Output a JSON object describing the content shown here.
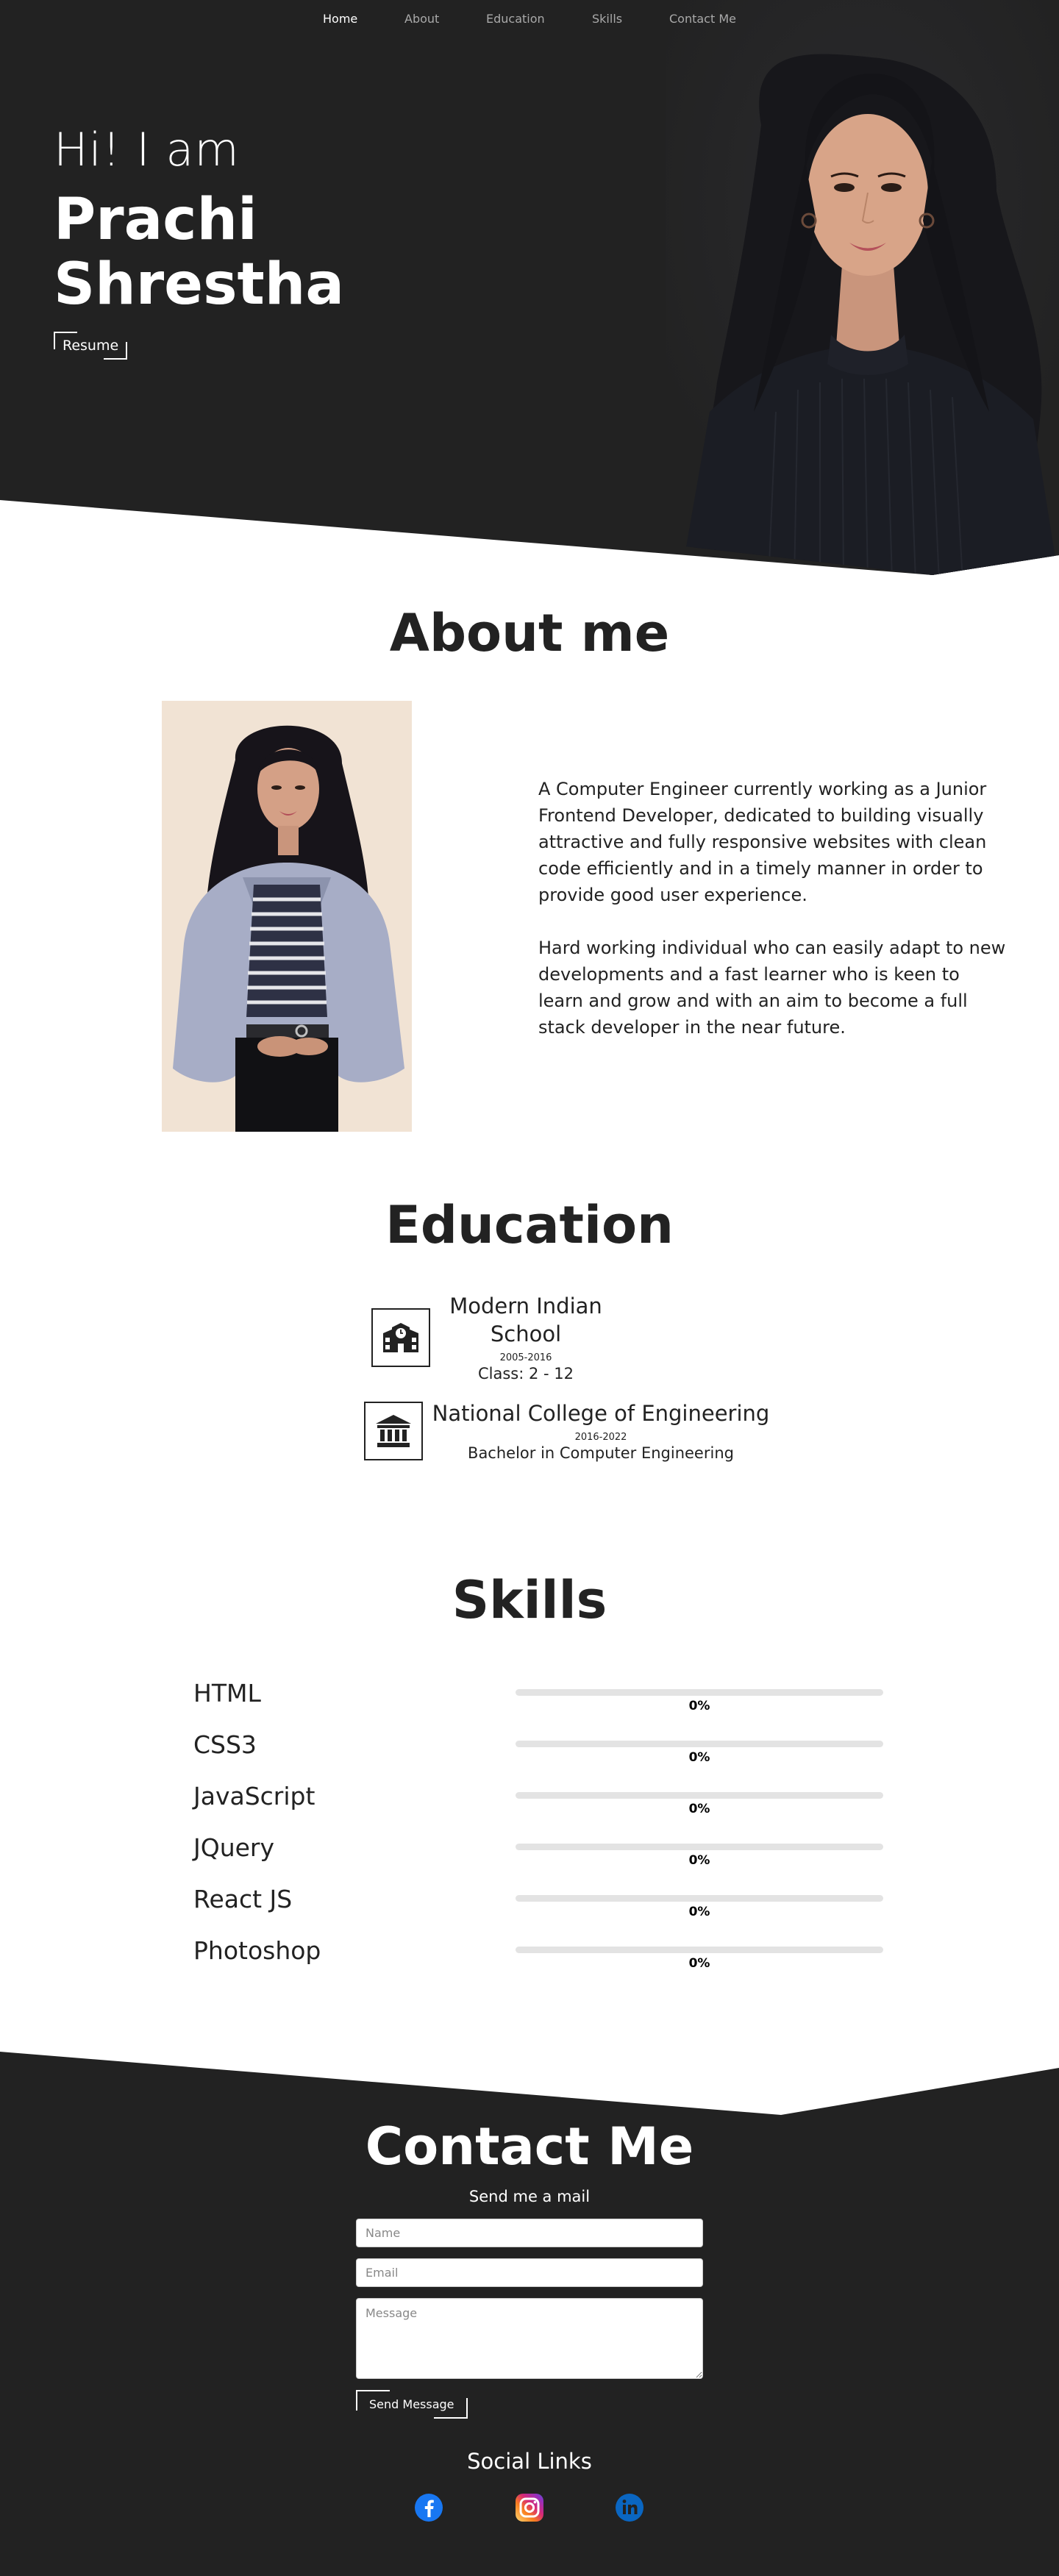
{
  "nav": {
    "items": [
      {
        "label": "Home",
        "active": true
      },
      {
        "label": "About",
        "active": false
      },
      {
        "label": "Education",
        "active": false
      },
      {
        "label": "Skills",
        "active": false
      },
      {
        "label": "Contact Me",
        "active": false
      }
    ]
  },
  "hero": {
    "greeting": "Hi! I am",
    "first_name": "Prachi",
    "last_name": "Shrestha",
    "resume_label": "Resume"
  },
  "about": {
    "title": "About me",
    "paragraphs": [
      "A Computer Engineer currently working as a Junior Frontend Developer, dedicated to building visually attractive and fully responsive websites with clean code efficiently and in a timely manner in order to provide good user experience.",
      "Hard working individual who can easily adapt to new developments and a fast learner who is keen to learn and grow and with an aim to become a full stack developer in the near future."
    ]
  },
  "education": {
    "title": "Education",
    "items": [
      {
        "name": "Modern Indian School",
        "years": "2005-2016",
        "detail": "Class: 2 - 12",
        "icon": "school-icon"
      },
      {
        "name": "National College of Engineering",
        "years": "2016-2022",
        "detail": "Bachelor in Computer Engineering",
        "icon": "university-icon"
      }
    ]
  },
  "skills": {
    "title": "Skills",
    "items": [
      {
        "name": "HTML",
        "percent_label": "0%",
        "progress": 0
      },
      {
        "name": "CSS3",
        "percent_label": "0%",
        "progress": 0
      },
      {
        "name": "JavaScript",
        "percent_label": "0%",
        "progress": 0
      },
      {
        "name": "JQuery",
        "percent_label": "0%",
        "progress": 0
      },
      {
        "name": "React JS",
        "percent_label": "0%",
        "progress": 0
      },
      {
        "name": "Photoshop",
        "percent_label": "0%",
        "progress": 0
      }
    ]
  },
  "contact": {
    "title": "Contact Me",
    "subtitle": "Send me a mail",
    "name_placeholder": "Name",
    "email_placeholder": "Email",
    "message_placeholder": "Message",
    "send_label": "Send Message",
    "social_title": "Social Links",
    "social": [
      {
        "name": "facebook-icon",
        "color": "#1877f2"
      },
      {
        "name": "instagram-icon",
        "color": "#d62976"
      },
      {
        "name": "linkedin-icon",
        "color": "#0a66c2"
      }
    ]
  },
  "colors": {
    "dark": "#222222",
    "light": "#ffffff",
    "track": "#e3e3e3"
  }
}
